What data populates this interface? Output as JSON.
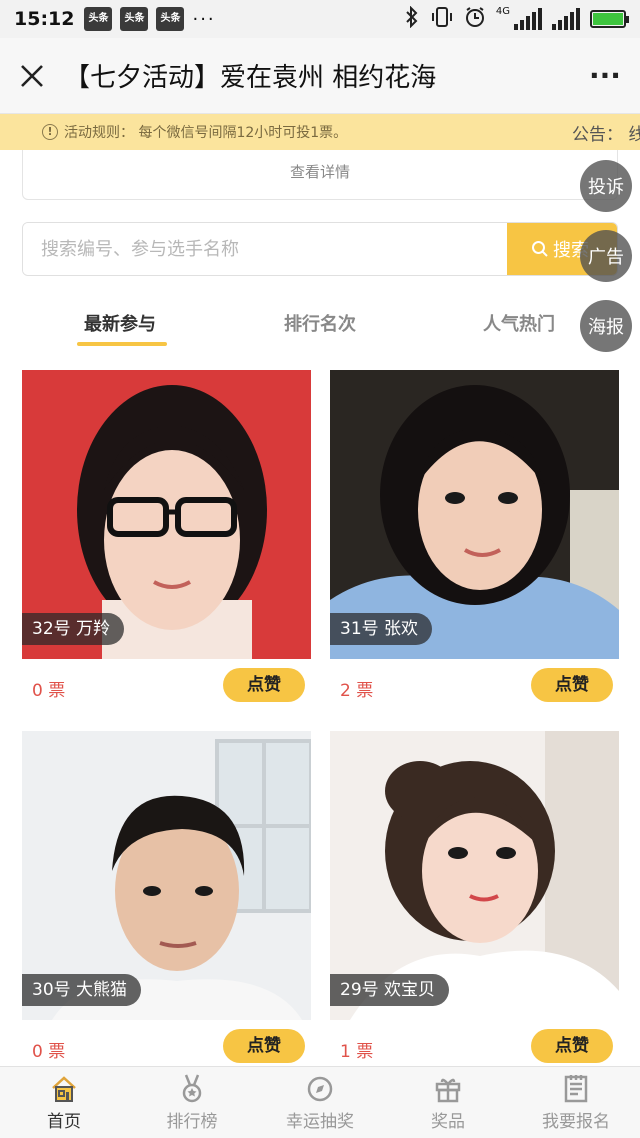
{
  "status_bar": {
    "time": "15:12",
    "app_badges": [
      "头条",
      "头条",
      "头条"
    ],
    "more": "···",
    "network": "4G"
  },
  "title_bar": {
    "close_icon": "close-icon",
    "title": "【七夕活动】爱在袁州 相约花海",
    "more_label": "···"
  },
  "notice": {
    "icon_label": "!",
    "text": "活动规则：  每个微信号间隔12小时可投1票。",
    "marquee": "公告：  线"
  },
  "details": {
    "label": "查看详情"
  },
  "search": {
    "placeholder": "搜索编号、参与选手名称",
    "button_label": "搜索"
  },
  "floating": {
    "complain": "投诉",
    "ad": "广告",
    "poster": "海报"
  },
  "tabs": [
    {
      "label": "最新参与",
      "active": true
    },
    {
      "label": "排行名次",
      "active": false
    },
    {
      "label": "人气热门",
      "active": false
    }
  ],
  "contestants": [
    {
      "tag": "32号 万羚",
      "votes": "0 票",
      "like": "点赞"
    },
    {
      "tag": "31号 张欢",
      "votes": "2 票",
      "like": "点赞"
    },
    {
      "tag": "30号 大熊猫",
      "votes": "0 票",
      "like": "点赞"
    },
    {
      "tag": "29号 欢宝贝",
      "votes": "1 票",
      "like": "点赞"
    }
  ],
  "bottom_nav": [
    {
      "label": "首页",
      "icon": "home-icon",
      "active": true
    },
    {
      "label": "排行榜",
      "icon": "medal-icon",
      "active": false
    },
    {
      "label": "幸运抽奖",
      "icon": "compass-icon",
      "active": false
    },
    {
      "label": "奖品",
      "icon": "gift-icon",
      "active": false
    },
    {
      "label": "我要报名",
      "icon": "form-icon",
      "active": false
    }
  ],
  "colors": {
    "accent": "#f7c544",
    "notice_bg": "#fbe49d",
    "votes": "#e0524a"
  }
}
